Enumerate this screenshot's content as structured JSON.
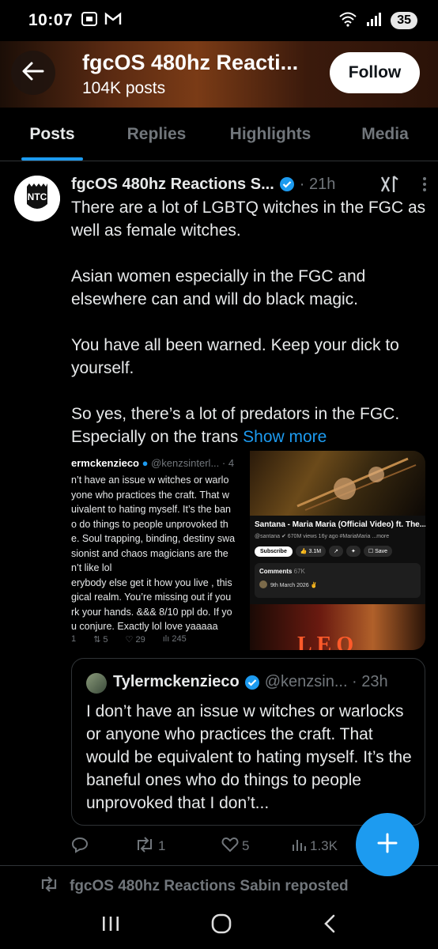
{
  "status_bar": {
    "time": "10:07",
    "battery": "35",
    "icons": [
      "screenshot-icon",
      "gmail-icon",
      "wifi-icon",
      "signal-icon",
      "battery-icon"
    ]
  },
  "header": {
    "title": "fgcOS 480hz Reacti...",
    "posts_count": "104K posts",
    "follow_label": "Follow"
  },
  "tabs": [
    {
      "label": "Posts",
      "active": true
    },
    {
      "label": "Replies",
      "active": false
    },
    {
      "label": "Highlights",
      "active": false
    },
    {
      "label": "Media",
      "active": false
    }
  ],
  "post": {
    "author": "fgcOS 480hz Reactions S...",
    "time": "· 21h",
    "paragraphs": [
      "There are a lot of LGBTQ witches in the FGC as well as female witches.",
      "Asian women especially in the FGC and elsewhere can and will do black magic.",
      "You have all been warned. Keep your dick to yourself.",
      "So yes, there’s a lot of predators in the FGC. Especially on the trans"
    ],
    "show_more": "Show more",
    "media_left": {
      "name": "ermckenzieco",
      "handle": "@kenzsinterl... · 4",
      "lines": [
        "n’t have an issue w witches or warlo",
        "yone who practices the craft. That w",
        "uivalent to hating myself. It’s the ban",
        "o do things to people unprovoked th",
        "e. Soul trapping, binding, destiny swa",
        "sionist and chaos magicians are the",
        "n’t like lol",
        "erybody else get it how you live , this",
        "gical realm. You’re missing out if you",
        "rk your hands. &&& 8/10 ppl do. If yo",
        "u conjure. Exactly lol love yaaaaa"
      ],
      "stats": [
        "1",
        "5",
        "29",
        "245"
      ]
    },
    "media_right": {
      "video_title": "Santana - Maria Maria (Official Video) ft. The...",
      "meta": "@santana ✔ 670M views 16y ago #MariaMaria ...more",
      "subscribe": "Subscribe",
      "likes": "3.1M",
      "save": "Save",
      "comments_label": "Comments",
      "comments_count": "67K",
      "comment_text": "9th March 2026 ✌",
      "thumb_text": "LEO"
    },
    "quote": {
      "name": "Tylermckenzieco",
      "handle": "@kenzsin... · 23h",
      "text": "I don’t have an issue w witches or warlocks or anyone who practices the craft. That would be equivalent to hating myself. It’s the baneful ones who do things to people unprovoked that I don’t..."
    },
    "actions": {
      "reposts": "1",
      "likes": "5",
      "views": "1.3K"
    }
  },
  "repost_notice": "fgcOS 480hz Reactions Sabin reposted",
  "colors": {
    "accent": "#1d9bf0",
    "background": "#000000",
    "text": "#e7e9ea",
    "muted": "#71767b"
  }
}
